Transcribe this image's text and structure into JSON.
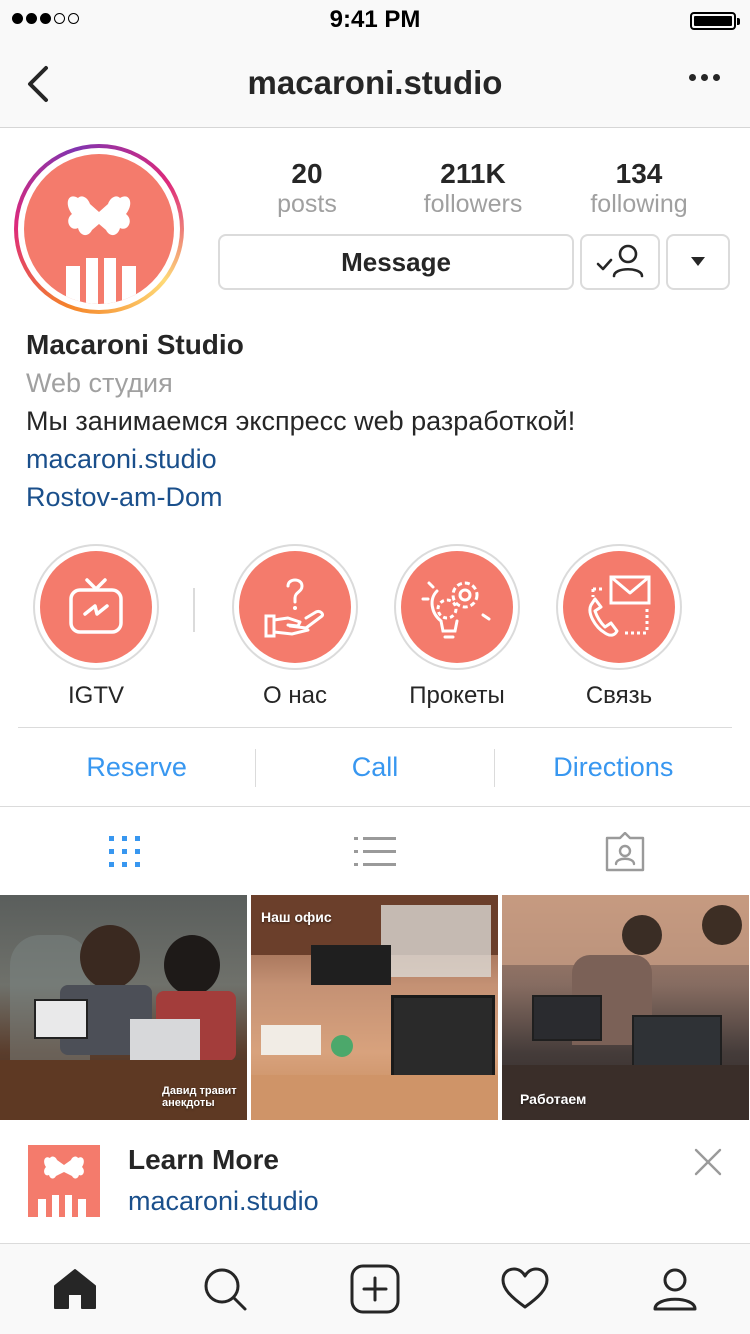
{
  "status_bar": {
    "time": "9:41 PM",
    "signal_bars": 3
  },
  "header": {
    "title": "macaroni.studio"
  },
  "profile": {
    "stats": [
      {
        "value": "20",
        "label": "posts"
      },
      {
        "value": "211K",
        "label": "followers"
      },
      {
        "value": "134",
        "label": "following"
      }
    ],
    "message_label": "Message",
    "name": "Macaroni Studio",
    "category": "Web студия",
    "description": "Мы занимаемся экспресс web разработкой!",
    "website": "macaroni.studio",
    "location": "Rostov-am-Dom"
  },
  "highlights": [
    {
      "label": "IGTV",
      "icon": "igtv-icon"
    },
    {
      "label": "О нас",
      "icon": "hand-question-icon"
    },
    {
      "label": "Прокеты",
      "icon": "lightbulb-gear-icon"
    },
    {
      "label": "Связь",
      "icon": "phone-envelope-icon"
    }
  ],
  "actions": [
    "Reserve",
    "Call",
    "Directions"
  ],
  "posts": [
    {
      "caption": "Давид травит анекдоты"
    },
    {
      "caption": "Наш офис"
    },
    {
      "caption": "Работаем"
    }
  ],
  "ad": {
    "title": "Learn More",
    "link": "macaroni.studio"
  },
  "colors": {
    "brand": "#f47b6c",
    "link": "#1a4f8b",
    "action_blue": "#3897f0"
  }
}
